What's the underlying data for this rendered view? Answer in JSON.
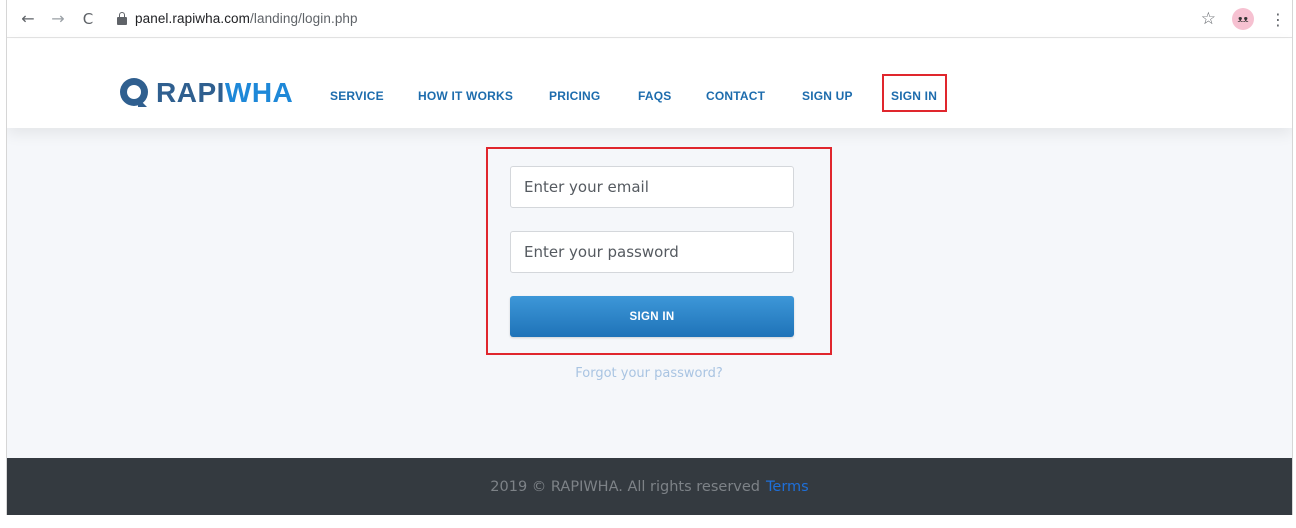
{
  "browser": {
    "url_domain": "panel.rapiwha.com",
    "url_path": "/landing/login.php",
    "back_glyph": "←",
    "forward_glyph": "→",
    "reload_glyph": "C",
    "star_glyph": "☆",
    "avatar_glyph": "ᴥᴥ",
    "menu_glyph": "⋮"
  },
  "logo": {
    "part1": "RAPI",
    "part2": "WHA",
    "colors": {
      "part1": "#2f5f8f",
      "part2": "#1e88d8"
    }
  },
  "nav": {
    "service": "SERVICE",
    "how_it_works": "HOW IT WORKS",
    "pricing": "PRICING",
    "faqs": "FAQS",
    "contact": "CONTACT",
    "sign_up": "SIGN UP",
    "sign_in": "SIGN IN",
    "color": "#1d6cad"
  },
  "login": {
    "email_placeholder": "Enter your email",
    "password_placeholder": "Enter your password",
    "submit_label": "SIGN IN",
    "forgot_label": "Forgot your password?",
    "button_color": "#1f73b8",
    "highlight_color": "#e0262d"
  },
  "footer": {
    "text": "2019 © RAPIWHA. All rights reserved",
    "terms_label": "Terms",
    "background": "#343a40"
  }
}
